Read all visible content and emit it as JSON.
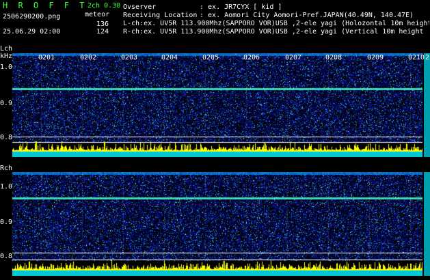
{
  "header": {
    "brand": "H R O F F T",
    "mode": "2ch 0.30",
    "filename": "2506290200.png",
    "datetime": "25.06.29 02:00",
    "meteor_label": "meteor",
    "lch_count": "136",
    "rch_count": "124",
    "observer_label": "Ovserver",
    "observer_value": ": ex. JR7CYX [ kid ]",
    "location_label": "Receiving Location",
    "location_value": ": ex. Aomori City Aomori-Pref.JAPAN(40.49N, 140.47E)",
    "lch_desc": "L-ch:ex. UV5R 113.900Mhz(SAPPORO VOR)USB ,2-ele yagi (Holozontal 10m height",
    "rch_desc": "R-ch:ex. UV5R 113.900Mhz(SAPPORO VOR)USB ,2-ele yagi (Vertical 10m height"
  },
  "lch": {
    "title": "Lch",
    "unit": "kHz",
    "ticks": [
      "1.0",
      "0.9",
      "0.8"
    ],
    "time_labels": [
      "0201",
      "0202",
      "0203",
      "0204",
      "0205",
      "0206",
      "0207",
      "0208",
      "0209",
      "0210"
    ],
    "edge_label": "2"
  },
  "rch": {
    "title": "Rch",
    "ticks": [
      "1.0",
      "0.9",
      "0.8"
    ]
  },
  "colors": {
    "noise": "#1a3cff",
    "carrier": "#40e0a0",
    "level": "#ffff00",
    "base": "#00c8d8"
  }
}
